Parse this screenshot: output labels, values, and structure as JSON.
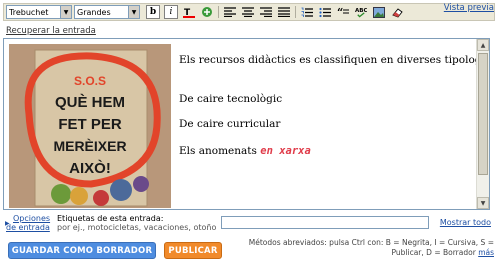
{
  "toolbar": {
    "font_family": "Trebuchet",
    "font_size": "Grandes",
    "bold_label": "b",
    "italic_label": "i",
    "preview_label": "Vista previa"
  },
  "recover_label": "Recuperar la entrada",
  "editor": {
    "image_text": [
      "S.O.S",
      "QUÈ HEM",
      "FET PER",
      "MERÈIXER",
      "AIXÒ!"
    ],
    "paragraph_1": "Els recursos didàctics es classifiquen en diverses tipologies:",
    "paragraph_2": "De caire tecnològic",
    "paragraph_3": "De caire curricular",
    "paragraph_4_prefix": "Els anomenats",
    "paragraph_4_highlight": "en xarxa",
    "highlight_color": "#e03c4a"
  },
  "labels": {
    "options_line1": "Opciones",
    "options_line2": "de entrada",
    "tags_label": "Etiquetas de esta entrada:",
    "tags_hint": "por ej., motocicletas, vacaciones, otoño",
    "tags_value": "",
    "show_all": "Mostrar todo"
  },
  "buttons": {
    "save_draft": "GUARDAR COMO BORRADOR",
    "publish": "PUBLICAR"
  },
  "shortcuts": {
    "line1": "Métodos abreviados: pulsa Ctrl con: B = Negrita, I = Cursiva, S =",
    "line2": "Publicar, D = Borrador",
    "more": "más"
  }
}
